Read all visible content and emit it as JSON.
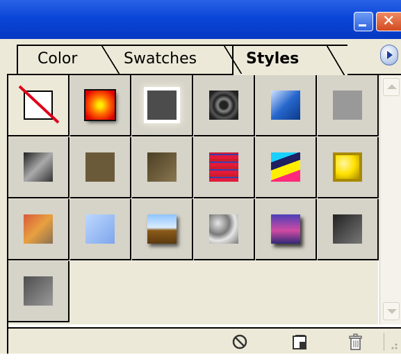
{
  "window": {
    "title_buttons": [
      "minimize",
      "close"
    ],
    "close_glyph": "✕"
  },
  "tabs": [
    {
      "label": "Color",
      "active": false
    },
    {
      "label": "Swatches",
      "active": false
    },
    {
      "label": "Styles",
      "active": true
    }
  ],
  "tab_menu_icon": "flyout-menu-arrow-icon",
  "styles": [
    {
      "name": "no-style",
      "kind": "none"
    },
    {
      "name": "red-glow",
      "colors": [
        "#ffee00",
        "#ff6a00",
        "#e00000",
        "#111111"
      ]
    },
    {
      "name": "outer-glow-gray",
      "colors": [
        "#4c4c4c",
        "#ffffff"
      ]
    },
    {
      "name": "dark-chrome-ring",
      "colors": [
        "#888888",
        "#222222"
      ]
    },
    {
      "name": "blue-bevel",
      "colors": [
        "#cfe3ff",
        "#2766cc",
        "#0c3a8a"
      ]
    },
    {
      "name": "flat-gray",
      "colors": [
        "#999999"
      ]
    },
    {
      "name": "smoke-gradient",
      "colors": [
        "#222222",
        "#aaaaaa",
        "#333333"
      ]
    },
    {
      "name": "olive-flat",
      "colors": [
        "#6b5a3a"
      ]
    },
    {
      "name": "olive-gradient",
      "colors": [
        "#4b3f24",
        "#8a7650"
      ]
    },
    {
      "name": "striped-red",
      "colors": [
        "#e21a3a",
        "#3a3fb0",
        "#d01c2a"
      ]
    },
    {
      "name": "neon-mix",
      "colors": [
        "#19d0ff",
        "#ffee00",
        "#1e1e60",
        "#ff2a7a"
      ]
    },
    {
      "name": "gold-bevel",
      "colors": [
        "#ffe100",
        "#a88900",
        "#fff6a0"
      ]
    },
    {
      "name": "sunset-gradient",
      "colors": [
        "#d85a3a",
        "#e8a040",
        "#8c7050"
      ]
    },
    {
      "name": "light-blue-soft",
      "colors": [
        "#bcd8ff",
        "#7fa6ec"
      ]
    },
    {
      "name": "sky-landscape",
      "colors": [
        "#8fc4ff",
        "#d9ecff",
        "#8a5a18",
        "#5c3a10"
      ]
    },
    {
      "name": "crumpled-texture",
      "colors": [
        "#e6e6e6",
        "#7a7a7a"
      ]
    },
    {
      "name": "violet-bevel",
      "colors": [
        "#4b3fb8",
        "#d14aa3",
        "#312a78"
      ]
    },
    {
      "name": "dark-gloss",
      "colors": [
        "#222222",
        "#777777"
      ]
    },
    {
      "name": "gray-shadow",
      "colors": [
        "#4e4e4e",
        "#9a9a9a"
      ]
    }
  ],
  "bottom": {
    "icons": [
      "clear-style-icon",
      "new-style-icon",
      "delete-style-icon",
      "resize-grip-icon"
    ]
  }
}
